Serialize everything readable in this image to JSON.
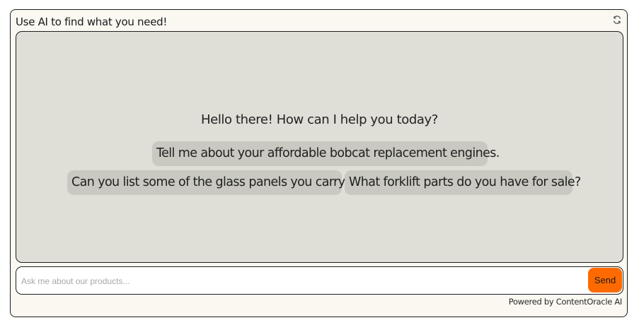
{
  "header": {
    "title": "Use AI to find what you need!",
    "refresh_icon": "refresh-icon"
  },
  "chat": {
    "greeting": "Hello there! How can I help you today?",
    "suggestions": [
      "Tell me about your affordable bobcat replacement engines.",
      "Can you list some of the glass panels you carry?",
      "What forklift parts do you have for sale?"
    ]
  },
  "input": {
    "value": "",
    "placeholder": "Ask me about our products...",
    "send_label": "Send"
  },
  "footer": {
    "powered_by": "Powered by ContentOracle AI"
  },
  "colors": {
    "accent": "#ff6a00",
    "chat_background": "#dfdfd7",
    "chip_background": "#c9c9c1",
    "widget_background": "#faf8f1"
  }
}
